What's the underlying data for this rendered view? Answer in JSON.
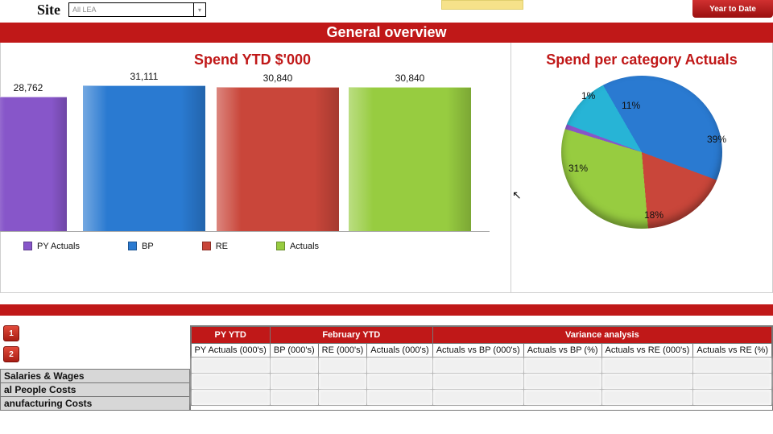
{
  "top": {
    "site_label": "Site",
    "site_value": "All LEA",
    "ytd_button": "Year to Date"
  },
  "ribbon": "General overview",
  "left_chart_title": "Spend YTD $'000",
  "right_chart_title": "Spend per category Actuals",
  "chart_data": [
    {
      "type": "bar",
      "title": "Spend YTD $'000",
      "categories": [
        "PY Actuals",
        "BP",
        "RE",
        "Actuals"
      ],
      "values": [
        28762,
        31111,
        30840,
        30840
      ],
      "colors": [
        "#8756c9",
        "#2a7ad1",
        "#c9463a",
        "#97cc40"
      ],
      "ylim": [
        0,
        32000
      ]
    },
    {
      "type": "pie",
      "title": "Spend per category Actuals",
      "slices": [
        {
          "label": "39%",
          "value": 39,
          "color": "#2a7ad1"
        },
        {
          "label": "18%",
          "value": 18,
          "color": "#c9463a"
        },
        {
          "label": "31%",
          "value": 31,
          "color": "#97cc40"
        },
        {
          "label": "1%",
          "value": 1,
          "color": "#8756c9"
        },
        {
          "label": "11%",
          "value": 11,
          "color": "#27b4d6"
        }
      ]
    }
  ],
  "legend": {
    "py": "PY Actuals",
    "bp": "BP",
    "re": "RE",
    "ac": "Actuals"
  },
  "tab": {
    "b1": "1",
    "b2": "2"
  },
  "categories": {
    "c1": "Salaries & Wages",
    "c2": "al People Costs",
    "c3": "anufacturing Costs"
  },
  "table": {
    "head_group": {
      "py": "PY YTD",
      "feb": "February YTD",
      "var": "Variance analysis"
    },
    "cols": {
      "pya": "PY Actuals (000's)",
      "bp": "BP (000's)",
      "re": "RE (000's)",
      "ac": "Actuals (000's)",
      "avbpk": "Actuals vs BP (000's)",
      "avbpp": "Actuals vs BP (%)",
      "avrek": "Actuals vs RE (000's)",
      "avrep": "Actuals vs RE (%)"
    }
  }
}
